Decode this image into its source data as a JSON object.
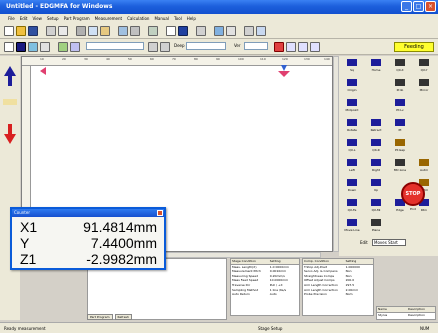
{
  "window": {
    "title": "Untitled - EDGMFA for Windows",
    "buttons": [
      "_",
      "□",
      "×"
    ]
  },
  "menu": [
    "File",
    "Edit",
    "View",
    "Setup",
    "Part Program",
    "Measurement",
    "Calculation",
    "Manual",
    "Tool",
    "Help"
  ],
  "toolbar3": {
    "ctl1": "Deep",
    "ctl2": "Ver"
  },
  "feeding": "Feeding",
  "ruler": [
    "10",
    "20",
    "30",
    "40",
    "50",
    "60",
    "70",
    "80",
    "90",
    "100",
    "110",
    "120",
    "130",
    "140"
  ],
  "panel_buttons": [
    {
      "label": "Sq",
      "icon": "square-icon",
      "color": "#1d1d9a"
    },
    {
      "label": "Home",
      "icon": "home-icon",
      "color": "#1d1d9a"
    },
    {
      "label": "QX-X",
      "icon": "axis-x-icon",
      "color": "#333333"
    },
    {
      "label": "QX-Y",
      "icon": "axis-y-icon",
      "color": "#333333"
    },
    {
      "label": "Origin",
      "icon": "origin-icon",
      "color": "#1d1d9a"
    },
    {
      "label": "",
      "icon": "blank-icon",
      "color": "#ece9d8"
    },
    {
      "label": "Prob",
      "icon": "probe-icon",
      "color": "#333333"
    },
    {
      "label": "Mirror",
      "icon": "mirror-icon",
      "color": "#333333"
    },
    {
      "label": "Midpoint",
      "icon": "midpoint-icon",
      "color": "#1d1d9a"
    },
    {
      "label": "",
      "icon": "blank-icon",
      "color": "#ece9d8"
    },
    {
      "label": "Pt:Lv",
      "icon": "point-icon",
      "color": "#1d1d9a"
    },
    {
      "label": "",
      "icon": "blank-icon",
      "color": "#ece9d8"
    },
    {
      "label": "Rotate",
      "icon": "rotate-icon",
      "color": "#1d1d9a"
    },
    {
      "label": "Retract",
      "icon": "retract-icon",
      "color": "#1d1d9a"
    },
    {
      "label": "Pt",
      "icon": "point-icon",
      "color": "#1d1d9a"
    },
    {
      "label": "",
      "icon": "blank-icon",
      "color": "#ece9d8"
    },
    {
      "label": "QX-L",
      "icon": "left-icon",
      "color": "#1d1d9a"
    },
    {
      "label": "QX-R",
      "icon": "right-icon",
      "color": "#1d1d9a"
    },
    {
      "label": "Pt:Gap",
      "icon": "gap-icon",
      "color": "#996600"
    },
    {
      "label": "",
      "icon": "blank-icon",
      "color": "#ece9d8"
    },
    {
      "label": "Left",
      "icon": "arrow-left-icon",
      "color": "#1d1d9a"
    },
    {
      "label": "Right",
      "icon": "arrow-right-icon",
      "color": "#1d1d9a"
    },
    {
      "label": "Mtr:Line",
      "icon": "line-icon",
      "color": "#333333"
    },
    {
      "label": "Autm",
      "icon": "auto-icon",
      "color": "#996600"
    },
    {
      "label": "Down",
      "icon": "arrow-down-icon",
      "color": "#1d1d9a"
    },
    {
      "label": "Up",
      "icon": "arrow-up-icon",
      "color": "#1d1d9a"
    },
    {
      "label": "",
      "icon": "blank-icon",
      "color": "#ece9d8"
    },
    {
      "label": "Autm",
      "icon": "auto-icon",
      "color": "#996600"
    },
    {
      "label": "QX-Fe",
      "icon": "feed-icon",
      "color": "#1d1d9a"
    },
    {
      "label": "QX-Mi",
      "icon": "mid-icon",
      "color": "#1d1d9a"
    },
    {
      "label": "Edge",
      "icon": "edge-icon",
      "color": "#1d1d9a"
    },
    {
      "label": "Rtrn",
      "icon": "return-icon",
      "color": "#1d1d9a"
    },
    {
      "label": "Move:Line",
      "icon": "move-icon",
      "color": "#1d1d9a"
    },
    {
      "label": "Plane",
      "icon": "plane-icon",
      "color": "#333333"
    }
  ],
  "stop": {
    "text": "STOP",
    "label": "End"
  },
  "edit": {
    "label": "Edit",
    "value": "Moves Start"
  },
  "bottom_tabs": [
    "Part Program",
    "Refresh"
  ],
  "status": {
    "left": "Ready measurement",
    "mid": "Stage Setup",
    "right": "NUM"
  },
  "coord_window": {
    "title": "Counter",
    "rows": [
      {
        "axis": "X1",
        "value": "91.4814mm"
      },
      {
        "axis": "Y",
        "value": "7.4400mm"
      },
      {
        "axis": "Z1",
        "value": "-2.9982mm"
      }
    ]
  },
  "grid1": {
    "headers": [
      "Stage Condition",
      "Setting"
    ],
    "rows": [
      [
        "Meas. Length(X)",
        "1.0 0000mm"
      ],
      [
        "Measurement Pitch",
        "0.0010mm"
      ],
      [
        "Measuring Speed",
        "0.20mm/s"
      ],
      [
        "Meas Feed Speed",
        "10.0000mm"
      ],
      [
        "Traverse Dir",
        "Pull / +X"
      ],
      [
        "Sampling Method",
        "1 line /6s/s"
      ],
      [
        "Auto Return",
        "Auto"
      ]
    ]
  },
  "grid2": {
    "headers": [
      "Comp. Condition",
      "Setting"
    ],
    "rows": [
      [
        "T.Stop Adj.Posit",
        "1.000000"
      ],
      [
        "Servo Adj. & Compens",
        "Non"
      ],
      [
        "Straightness Comps",
        "Non"
      ],
      [
        "Offset Adjust Comps",
        "200.0"
      ],
      [
        "Arm Length Correction",
        "297.5"
      ],
      [
        "Arm Length Correction",
        "2.00mm"
      ],
      [
        "Probe Precision",
        "Nom"
      ]
    ]
  },
  "grid3": {
    "headers": [
      "Name",
      "Description"
    ],
    "rows": [
      [
        "Stylus",
        "Description"
      ]
    ]
  }
}
